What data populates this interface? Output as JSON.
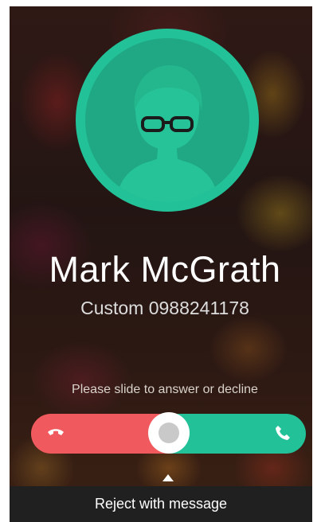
{
  "caller": {
    "name": "Mark McGrath",
    "number": "Custom 0988241178"
  },
  "slider": {
    "hint": "Please slide to answer or decline",
    "decline_icon": "hang-up-icon",
    "answer_icon": "phone-icon",
    "decline_color": "#f05a5e",
    "answer_color": "#22c197"
  },
  "reject": {
    "label": "Reject with message",
    "icon": "caret-up-icon"
  },
  "colors": {
    "avatar": "#22c197",
    "avatar_inner": "#1fa883"
  }
}
